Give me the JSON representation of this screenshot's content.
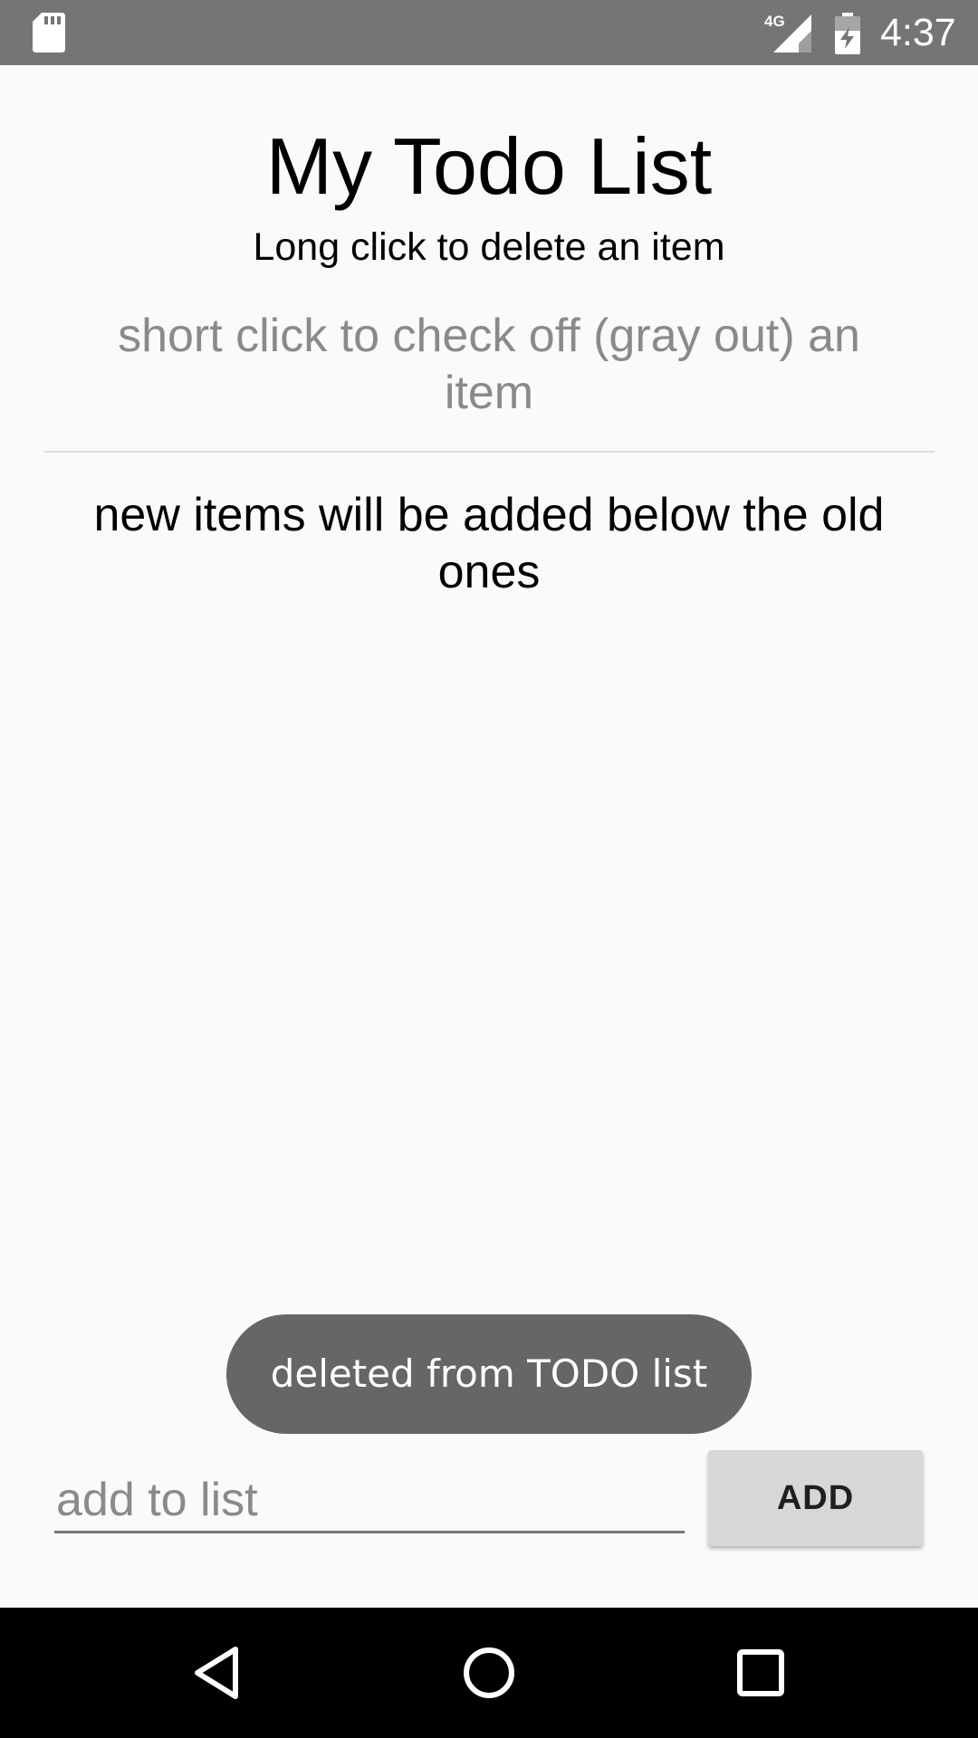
{
  "status_bar": {
    "time": "4:37",
    "network_label": "4G",
    "icons": [
      "sd-card-icon",
      "signal-4g-icon",
      "battery-charging-icon"
    ],
    "background_color": "#757575"
  },
  "header": {
    "title": "My Todo List",
    "subtitle": "Long click to delete an item"
  },
  "todo_items": [
    {
      "text": "short click to check off (gray out) an item",
      "checked": true
    },
    {
      "text": "new items will be added below the old ones",
      "checked": false
    }
  ],
  "toast": {
    "message": "deleted from TODO list"
  },
  "input": {
    "placeholder": "add to list",
    "value": ""
  },
  "add_button": {
    "label": "ADD"
  },
  "nav_bar": {
    "icons": [
      "back-icon",
      "home-icon",
      "recents-icon"
    ]
  },
  "colors": {
    "background": "#fafafa",
    "checked_text": "#8a8a8a",
    "toast_background": "#666666",
    "button_background": "#d6d7d7"
  }
}
